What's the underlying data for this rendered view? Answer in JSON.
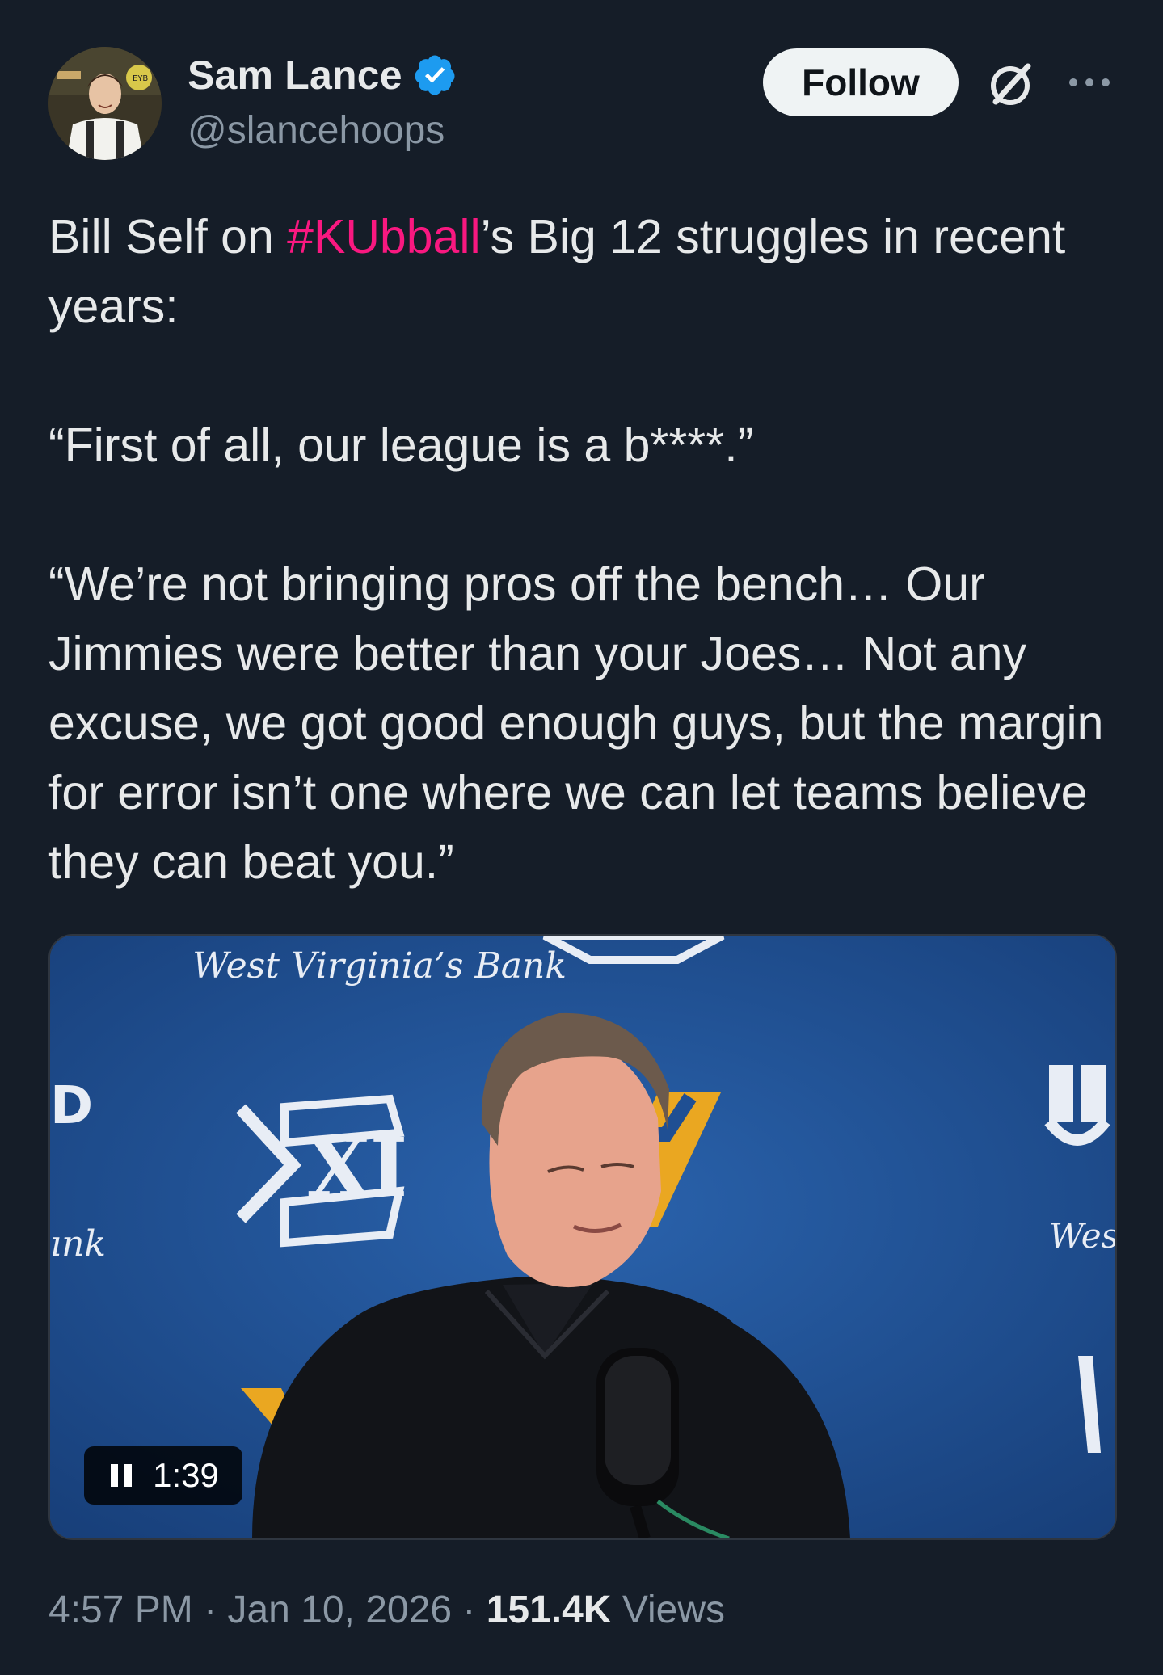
{
  "author": {
    "name": "Sam Lance",
    "handle": "@slancehoops",
    "verified_color": "#1d9bf0"
  },
  "header": {
    "follow_label": "Follow",
    "grok_icon": "grok-icon",
    "more_icon": "more-options-icon"
  },
  "tweet": {
    "line1_pre": "Bill Self on ",
    "hashtag": "#KUbball",
    "line1_post": "’s Big 12 struggles in recent years:",
    "quote1": "“First of all, our league is a b****.”",
    "quote2": "“We’re not bringing pros off the bench… Our Jimmies were better than your Joes… Not any excuse, we got good enough guys, but the margin for error isn’t one where we can let teams believe they can beat you.”",
    "hashtag_color": "#f91880"
  },
  "media": {
    "backdrop_text": "West Virginia’s Bank",
    "edge_left_letter": "D",
    "edge_left_text": "ınk",
    "edge_right_text": "Wes",
    "backdrop_text_2": "D",
    "duration": "1:39",
    "pause_icon": "pause-icon"
  },
  "meta": {
    "time": "4:57 PM",
    "separator": "·",
    "date": "Jan 10, 2026",
    "views_count": "151.4K",
    "views_label": "Views"
  }
}
